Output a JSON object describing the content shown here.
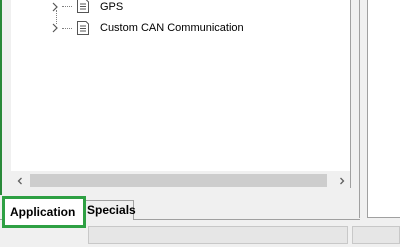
{
  "tree": {
    "items": [
      {
        "label": "GPS",
        "icon": "document-icon",
        "expander": "chevron-right-icon"
      },
      {
        "label": "Custom CAN Communication",
        "icon": "document-icon",
        "expander": "chevron-right-icon"
      }
    ]
  },
  "tabs": [
    {
      "label": "Application",
      "active": true,
      "highlight_color": "#2ea043"
    },
    {
      "label": "Specials",
      "active": false
    }
  ],
  "scrollbar": {
    "left_icon": "chevron-left-icon",
    "right_icon": "chevron-right-icon"
  },
  "colors": {
    "highlight": "#2ea043",
    "panel_background": "#ffffff",
    "chrome_background": "#f0f0f0"
  }
}
